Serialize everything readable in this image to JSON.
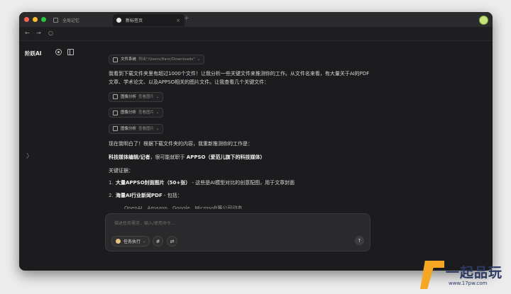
{
  "browser": {
    "tabs": [
      {
        "label": "全局记忆",
        "active": false
      },
      {
        "label": "新标签页",
        "active": true
      }
    ],
    "new_tab_symbol": "+",
    "close_symbol": "×",
    "nav": {
      "back": "←",
      "forward": "→",
      "reload": "○"
    }
  },
  "sidebar": {
    "brand": "阶跃AI",
    "new_chat_icon": "new-chat-icon",
    "panel_icon": "sidebar-panel-icon",
    "expand_symbol": "〉"
  },
  "chat": {
    "filesystem_chip": {
      "label": "文件系统",
      "detail": "列出\"/Users/lfanr/Downloads\""
    },
    "intro": "我看到下载文件夹里有超过1000个文件！让我分析一些关键文件来推测你的工作。从文件名来看，有大量关于AI的PDF文章、学术论文、以及APPSO相关的图片文件。让我查看几个关键文件：",
    "image_chips": [
      {
        "label": "图像分析",
        "detail": "查看图片"
      },
      {
        "label": "图像分析",
        "detail": "查看图片"
      },
      {
        "label": "图像分析",
        "detail": "查看图片"
      }
    ],
    "conclusion": "现在我明白了！根据下载文件夹的内容，我重新推测你的工作是：",
    "role_bold": "科技媒体编辑/记者",
    "role_mid": "，很可能就职于 ",
    "role_bold2": "APPSO（爱范儿旗下的科技媒体）",
    "evidence_title": "关键证据：",
    "evidence": [
      {
        "num": "1.",
        "bold": "大量APPSO封面图片（50+张）",
        "rest": " - 这些是AI模型对比的创意配图，用于文章封面"
      },
      {
        "num": "2.",
        "bold": "海量AI行业新闻PDF",
        "rest": " - 包括："
      }
    ],
    "cut_line": "OpenAI、Amazon、Google、Microsoft等公司动态"
  },
  "composer": {
    "placeholder": "描述任务需求，输入/使用命令…",
    "mode_label": "任务执行",
    "hash_symbol": "#",
    "tool_symbol": "⇄",
    "send_symbol": "↑"
  },
  "watermark": {
    "text": "一起品玩",
    "url": "www.17pw.com"
  }
}
